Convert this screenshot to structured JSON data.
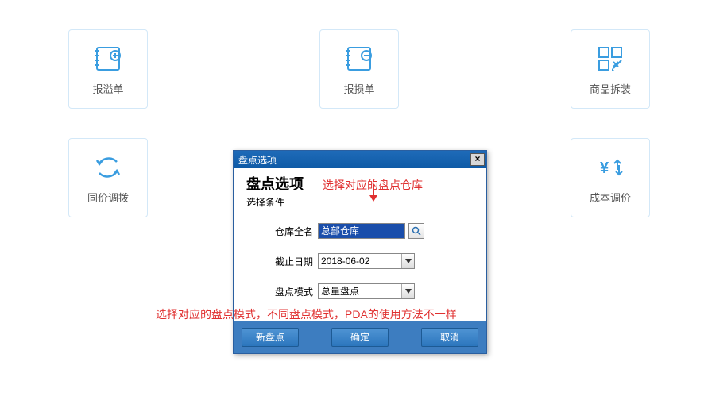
{
  "cards": {
    "overflow": "报溢单",
    "loss": "报损单",
    "assembly": "商品拆装",
    "same_price": "同价调拨",
    "cost_adj": "成本调价"
  },
  "dialog": {
    "titlebar": "盘点选项",
    "heading": "盘点选项",
    "subheading": "选择条件",
    "fields": {
      "warehouse_label": "仓库全名",
      "warehouse_value": "总部仓库",
      "date_label": "截止日期",
      "date_value": "2018-06-02",
      "mode_label": "盘点模式",
      "mode_value": "总量盘点"
    },
    "buttons": {
      "new": "新盘点",
      "ok": "确定",
      "cancel": "取消"
    },
    "close": "×"
  },
  "annotations": {
    "top": "选择对应的盘点仓库",
    "bottom": "选择对应的盘点模式，不同盘点模式，PDA的使用方法不一样"
  }
}
